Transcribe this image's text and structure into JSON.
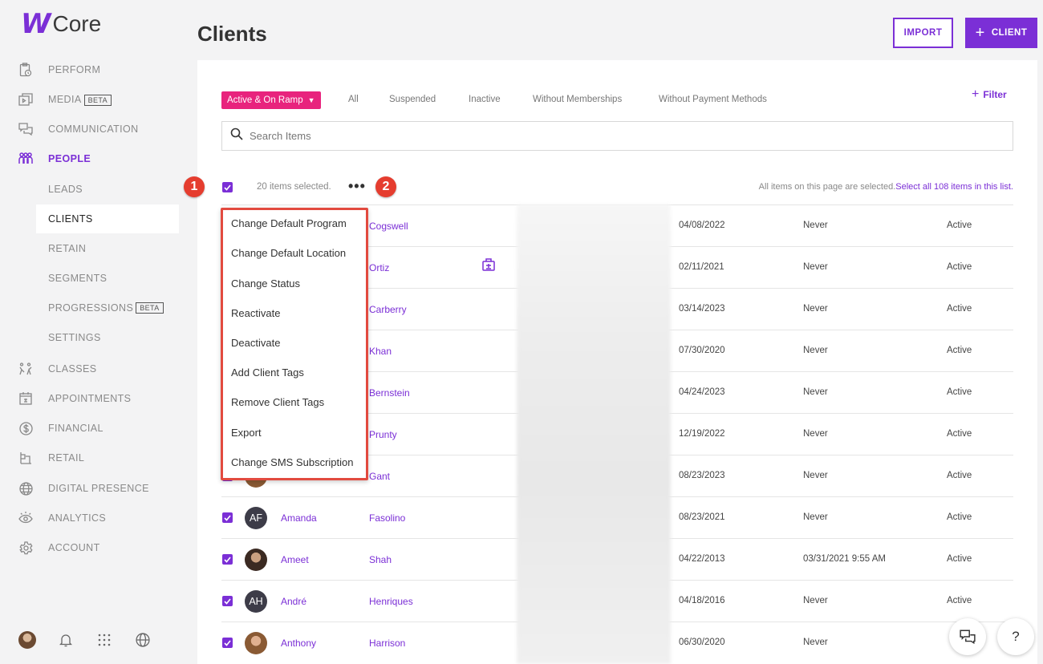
{
  "app": {
    "logo_letter": "W",
    "logo_text": "Core"
  },
  "sidebar": {
    "items": [
      {
        "label": "PERFORM",
        "icon": "clipboard-clock-icon"
      },
      {
        "label": "MEDIA",
        "badge": "BETA",
        "icon": "media-icon"
      },
      {
        "label": "COMMUNICATION",
        "icon": "chat-icon"
      },
      {
        "label": "PEOPLE",
        "icon": "people-icon",
        "active": true
      },
      {
        "label": "CLASSES",
        "icon": "classes-icon"
      },
      {
        "label": "APPOINTMENTS",
        "icon": "calendar-icon"
      },
      {
        "label": "FINANCIAL",
        "icon": "dollar-icon"
      },
      {
        "label": "RETAIL",
        "icon": "retail-icon"
      },
      {
        "label": "DIGITAL PRESENCE",
        "icon": "globe-icon"
      },
      {
        "label": "ANALYTICS",
        "icon": "eye-icon"
      },
      {
        "label": "ACCOUNT",
        "icon": "gear-icon"
      }
    ],
    "people_sub": [
      {
        "label": "LEADS"
      },
      {
        "label": "CLIENTS",
        "active": true
      },
      {
        "label": "RETAIN"
      },
      {
        "label": "SEGMENTS"
      },
      {
        "label": "PROGRESSIONS",
        "badge": "BETA"
      },
      {
        "label": "SETTINGS"
      }
    ]
  },
  "header": {
    "title": "Clients",
    "import_label": "IMPORT",
    "client_label": "CLIENT"
  },
  "filters": {
    "active_label": "Active & On Ramp",
    "tabs": [
      "All",
      "Suspended",
      "Inactive",
      "Without Memberships",
      "Without Payment Methods"
    ],
    "filter_label": "Filter"
  },
  "search": {
    "placeholder": "Search Items"
  },
  "selection": {
    "count_text": "20 items selected.",
    "info_text": "All items on this page are selected.",
    "select_all_text": "Select all 108 items in this list."
  },
  "annotations": {
    "badge1": "1",
    "badge2": "2"
  },
  "menu": {
    "items": [
      "Change Default Program",
      "Change Default Location",
      "Change Status",
      "Reactivate",
      "Deactivate",
      "Add Client Tags",
      "Remove Client Tags",
      "Export",
      "Change SMS Subscription"
    ]
  },
  "rows": [
    {
      "first": "",
      "last": "Cogswell",
      "date": "04/08/2022",
      "last_visit": "Never",
      "status": "Active"
    },
    {
      "first": "",
      "last": "Ortiz",
      "date": "02/11/2021",
      "last_visit": "Never",
      "status": "Active",
      "tag": true
    },
    {
      "first": "",
      "last": "Carberry",
      "date": "03/14/2023",
      "last_visit": "Never",
      "status": "Active"
    },
    {
      "first": "",
      "last": "Khan",
      "date": "07/30/2020",
      "last_visit": "Never",
      "status": "Active"
    },
    {
      "first": "",
      "last": "Bernstein",
      "date": "04/24/2023",
      "last_visit": "Never",
      "status": "Active"
    },
    {
      "first": "",
      "last": "Prunty",
      "date": "12/19/2022",
      "last_visit": "Never",
      "status": "Active"
    },
    {
      "first": "",
      "last": "Gant",
      "date": "08/23/2023",
      "last_visit": "Never",
      "status": "Active"
    },
    {
      "first": "Amanda",
      "last": "Fasolino",
      "initials": "AF",
      "date": "08/23/2021",
      "last_visit": "Never",
      "status": "Active"
    },
    {
      "first": "Ameet",
      "last": "Shah",
      "date": "04/22/2013",
      "last_visit": "03/31/2021 9:55 AM",
      "status": "Active"
    },
    {
      "first": "André",
      "last": "Henriques",
      "initials": "AH",
      "date": "04/18/2016",
      "last_visit": "Never",
      "status": "Active"
    },
    {
      "first": "Anthony",
      "last": "Harrison",
      "date": "06/30/2020",
      "last_visit": "Never",
      "status": ""
    }
  ],
  "colors": {
    "accent": "#7b2fd6",
    "pill": "#e8237d",
    "annotation": "#e24a3f"
  }
}
